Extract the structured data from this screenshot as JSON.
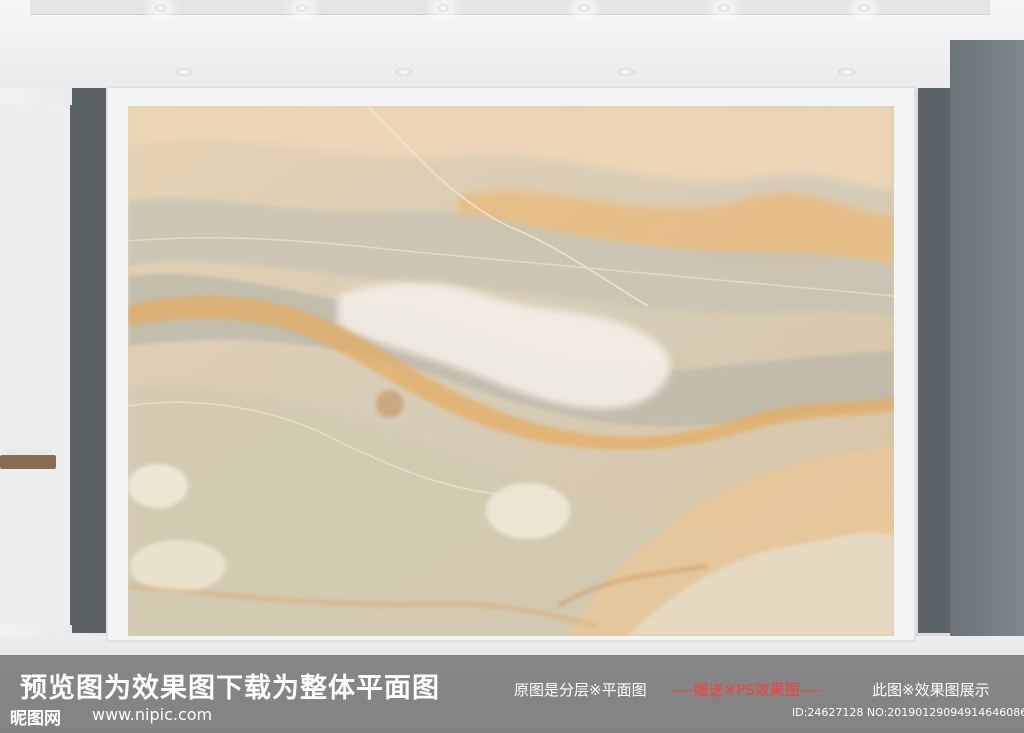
{
  "watermark": {
    "main_text": "预览图为效果图下载为整体平面图",
    "note_left": "原图是分层※平面图",
    "note_middle": "----赠送※PS效果图----",
    "note_right": "此图※效果图展示",
    "logo_text": "昵图网",
    "url": "www.nipic.com",
    "id_text": "ID:24627128 NO:20190129094914646086"
  },
  "colors": {
    "marble_base": "#d8cbb3",
    "marble_amber": "#e8b878",
    "marble_grey": "#b9b4a6",
    "frame": "#f3f4f4",
    "wall_panel": "#596165",
    "watermark_red": "#ff3b3b"
  }
}
